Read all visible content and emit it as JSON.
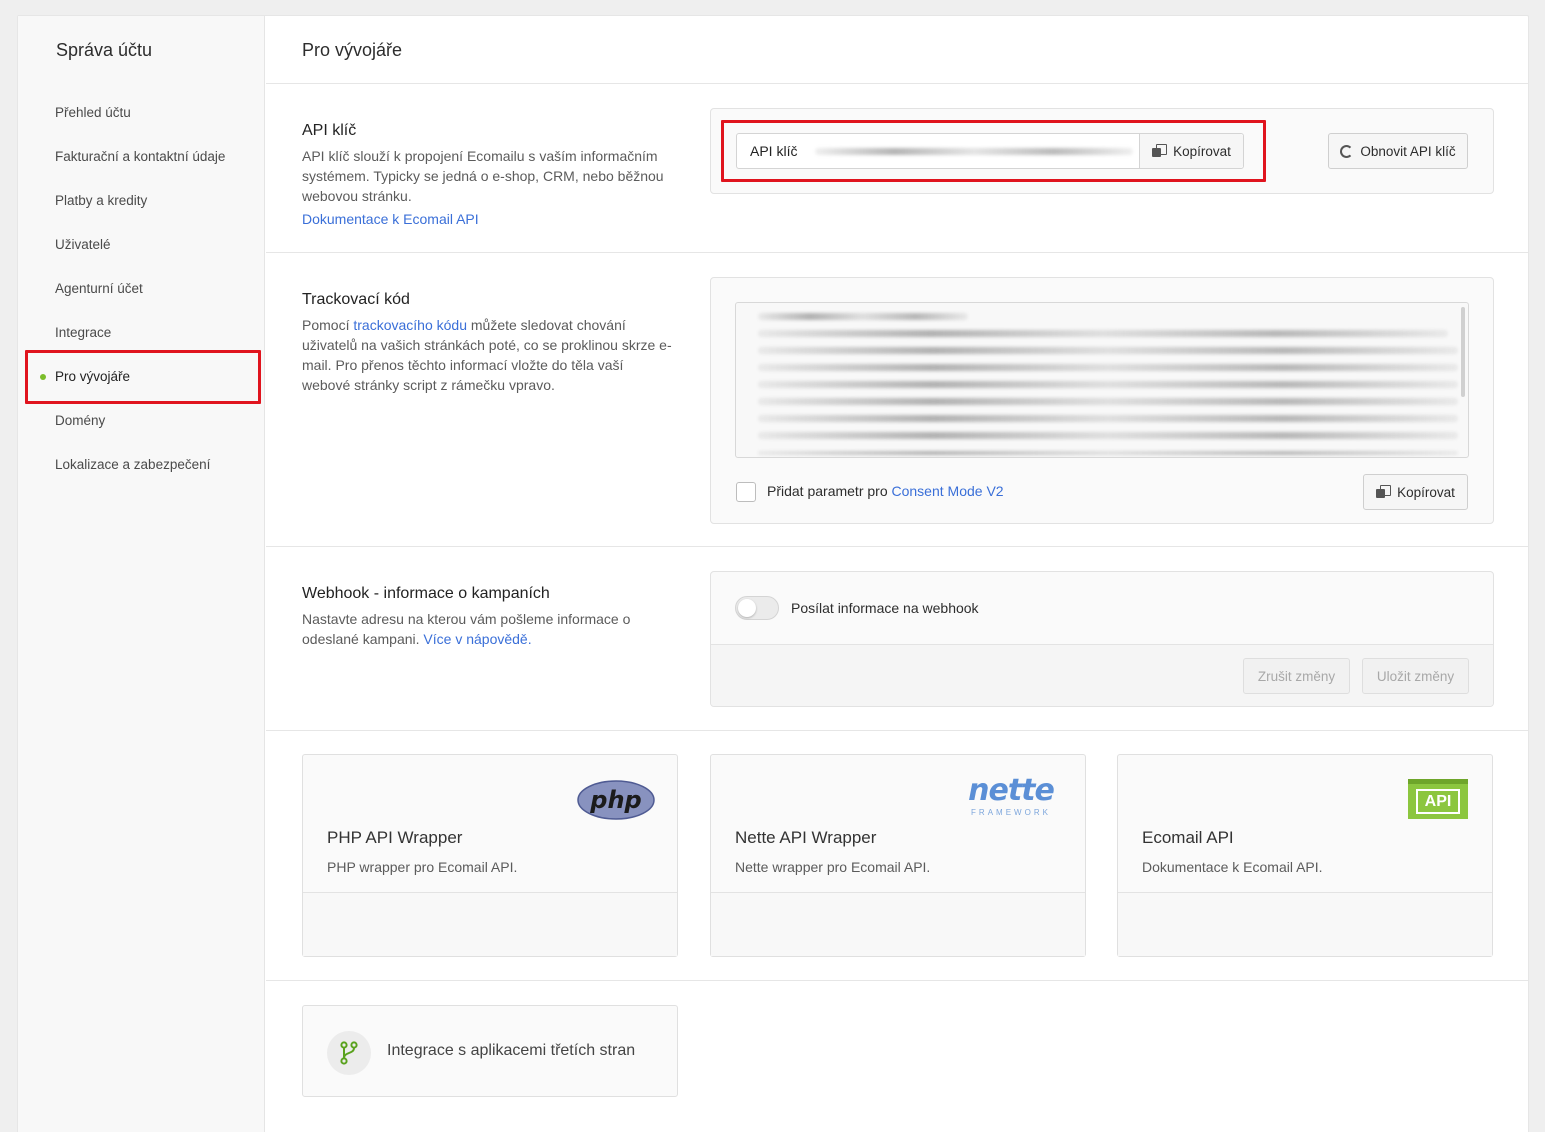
{
  "sidebar": {
    "title": "Správa účtu",
    "items": [
      {
        "label": "Přehled účtu"
      },
      {
        "label": "Fakturační a kontaktní údaje"
      },
      {
        "label": "Platby a kredity"
      },
      {
        "label": "Uživatelé"
      },
      {
        "label": "Agenturní účet"
      },
      {
        "label": "Integrace"
      },
      {
        "label": "Pro vývojáře",
        "active": true
      },
      {
        "label": "Domény"
      },
      {
        "label": "Lokalizace a zabezpečení"
      }
    ]
  },
  "page": {
    "title": "Pro vývojáře"
  },
  "api_key": {
    "title": "API klíč",
    "desc": "API klíč slouží k propojení Ecomailu s vaším informačním systémem. Typicky se jedná o e-shop, CRM, nebo běžnou webovou stránku.",
    "doc_link": "Dokumentace k Ecomail API",
    "field_label": "API klíč",
    "copy_label": "Kopírovat",
    "refresh_label": "Obnovit API klíč"
  },
  "tracking": {
    "title": "Trackovací kód",
    "desc_before": "Pomocí ",
    "desc_link": "trackovacího kódu",
    "desc_after": " můžete sledovat chování uživatelů na vašich stránkách poté, co se proklinou skrze e-mail. Pro přenos těchto informací vložte do těla vaší webové stránky script z rámečku vpravo.",
    "checkbox_label": "Přidat parametr pro ",
    "checkbox_link": "Consent Mode V2",
    "copy_label": "Kopírovat"
  },
  "webhook": {
    "title": "Webhook - informace o kampaních",
    "desc": "Nastavte adresu na kterou vám pošleme informace o odeslané kampani. ",
    "desc_link": "Více v nápovědě.",
    "toggle_label": "Posílat informace na webhook",
    "toggle_on": false,
    "cancel_label": "Zrušit změny",
    "save_label": "Uložit změny"
  },
  "tiles": [
    {
      "title": "PHP API Wrapper",
      "desc": "PHP wrapper pro Ecomail API.",
      "logo": "php"
    },
    {
      "title": "Nette API Wrapper",
      "desc": "Nette wrapper pro Ecomail API.",
      "logo": "nette",
      "logo_sub": "FRAMEWORK"
    },
    {
      "title": "Ecomail API",
      "desc": "Dokumentace k Ecomail API.",
      "logo": "API"
    }
  ],
  "integration": {
    "label": "Integrace s aplikacemi třetích stran",
    "icon": "branch-icon"
  },
  "colors": {
    "accent": "#7bbd2a",
    "link": "#3a6fd8",
    "highlight": "#e0141e"
  }
}
